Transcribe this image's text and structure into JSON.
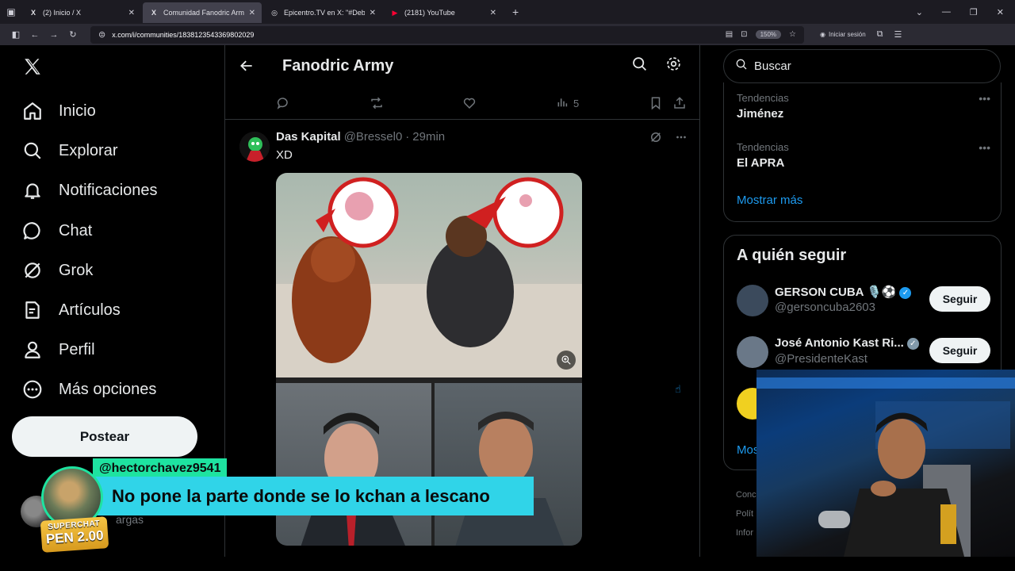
{
  "browser": {
    "tabs": [
      {
        "label": "(2) Inicio / X",
        "favicon": "X"
      },
      {
        "label": "Comunidad Fanodric Army / X",
        "favicon": "X"
      },
      {
        "label": "Epicentro.TV en X: \"#Debat",
        "favicon": "◎"
      },
      {
        "label": "(2181) YouTube",
        "favicon": "▶"
      }
    ],
    "active_tab": 1,
    "url": "x.com/i/communities/1838123543369802029",
    "zoom": "150%",
    "login_label": "Iniciar sesión"
  },
  "sidebar": {
    "items": [
      {
        "label": "Inicio",
        "icon": "home-icon"
      },
      {
        "label": "Explorar",
        "icon": "search-icon"
      },
      {
        "label": "Notificaciones",
        "icon": "bell-icon"
      },
      {
        "label": "Chat",
        "icon": "chat-icon"
      },
      {
        "label": "Grok",
        "icon": "grok-icon"
      },
      {
        "label": "Artículos",
        "icon": "article-icon"
      },
      {
        "label": "Perfil",
        "icon": "profile-icon"
      },
      {
        "label": "Más opciones",
        "icon": "more-icon"
      }
    ],
    "post_label": "Postear",
    "account_name_fragment": "argas"
  },
  "community": {
    "title": "Fanodric Army",
    "prev_post_views": "5"
  },
  "post": {
    "author": "Das Kapital",
    "handle": "@Bressel0",
    "time": "29min",
    "text": "XD"
  },
  "right": {
    "search_placeholder": "Buscar",
    "trends": [
      {
        "category": "Tendencias",
        "name": "Jiménez"
      },
      {
        "category": "Tendencias",
        "name": "El APRA"
      }
    ],
    "show_more": "Mostrar más",
    "follow_title": "A quién seguir",
    "follow": [
      {
        "name": "GERSON CUBA 🎙️⚽",
        "handle": "@gersoncuba2603",
        "button": "Seguir",
        "avatar_color": "#3b4a5c"
      },
      {
        "name": "José Antonio Kast Ri...",
        "handle": "@PresidenteKast",
        "button": "Seguir",
        "avatar_color": "#6a7888"
      }
    ],
    "follow_more_fragment": "Mos",
    "footer_fragments": [
      "Conc",
      "Polít",
      "Infor"
    ]
  },
  "overlay": {
    "superchat_user": "@hectorchavez9541",
    "superchat_message": "No pone la parte donde se lo kchan a lescano",
    "superchat_label": "SUPERCHAT",
    "superchat_amount": "PEN 2.00"
  },
  "colors": {
    "accent": "#1d9bf0",
    "superchat_green": "#1ee3a0",
    "superchat_cyan": "#30d4e8"
  }
}
